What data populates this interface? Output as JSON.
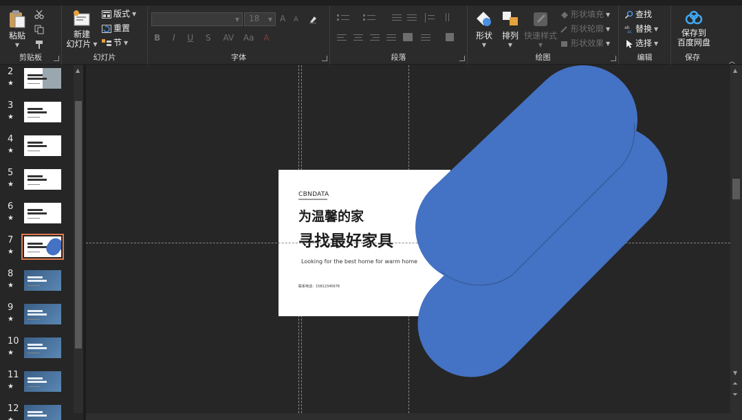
{
  "colors": {
    "ribbon_bg": "#2b2b2b",
    "canvas_bg": "#262626",
    "shape_fill": "#4472c4",
    "selection_outline": "#e0784e"
  },
  "ribbon": {
    "clipboard": {
      "label": "剪贴板",
      "paste": "粘贴",
      "cut_icon": "scissors-icon",
      "copy_icon": "copy-icon",
      "painter_icon": "format-painter-icon"
    },
    "slides": {
      "label": "幻灯片",
      "new_slide_line1": "新建",
      "new_slide_line2": "幻灯片",
      "layout": "版式",
      "reset": "重置",
      "section": "节"
    },
    "font": {
      "label": "字体",
      "font_name": "",
      "font_size": "18",
      "bold": "B",
      "italic": "I",
      "underline": "U",
      "strike": "S",
      "spacing": "AV",
      "case": "Aa",
      "grow": "A",
      "shrink": "A",
      "clear": "clear-format-icon",
      "color": "A"
    },
    "paragraph": {
      "label": "段落"
    },
    "drawing": {
      "label": "绘图",
      "shapes": "形状",
      "arrange": "排列",
      "quick_styles": "快速样式",
      "shape_fill": "形状填充",
      "shape_outline": "形状轮廓",
      "shape_effects": "形状效果"
    },
    "editing": {
      "label": "编辑",
      "find": "查找",
      "replace": "替换",
      "select": "选择"
    },
    "save": {
      "label": "保存",
      "save_line1": "保存到",
      "save_line2": "百度网盘"
    }
  },
  "thumbnails": [
    {
      "number": "2",
      "style": "photo"
    },
    {
      "number": "3",
      "style": "white"
    },
    {
      "number": "4",
      "style": "white"
    },
    {
      "number": "5",
      "style": "white"
    },
    {
      "number": "6",
      "style": "white"
    },
    {
      "number": "7",
      "style": "selected"
    },
    {
      "number": "8",
      "style": "blue"
    },
    {
      "number": "9",
      "style": "blue"
    },
    {
      "number": "10",
      "style": "blue"
    },
    {
      "number": "11",
      "style": "blue"
    },
    {
      "number": "12",
      "style": "blue"
    }
  ],
  "thumb_star": "★",
  "slide": {
    "logo": "CBNDATA",
    "title_line1": "为温馨的家",
    "title_line2": "寻找最好家具",
    "english": "Looking for the best home for warm home",
    "contact": "联系电话：15812345678"
  }
}
